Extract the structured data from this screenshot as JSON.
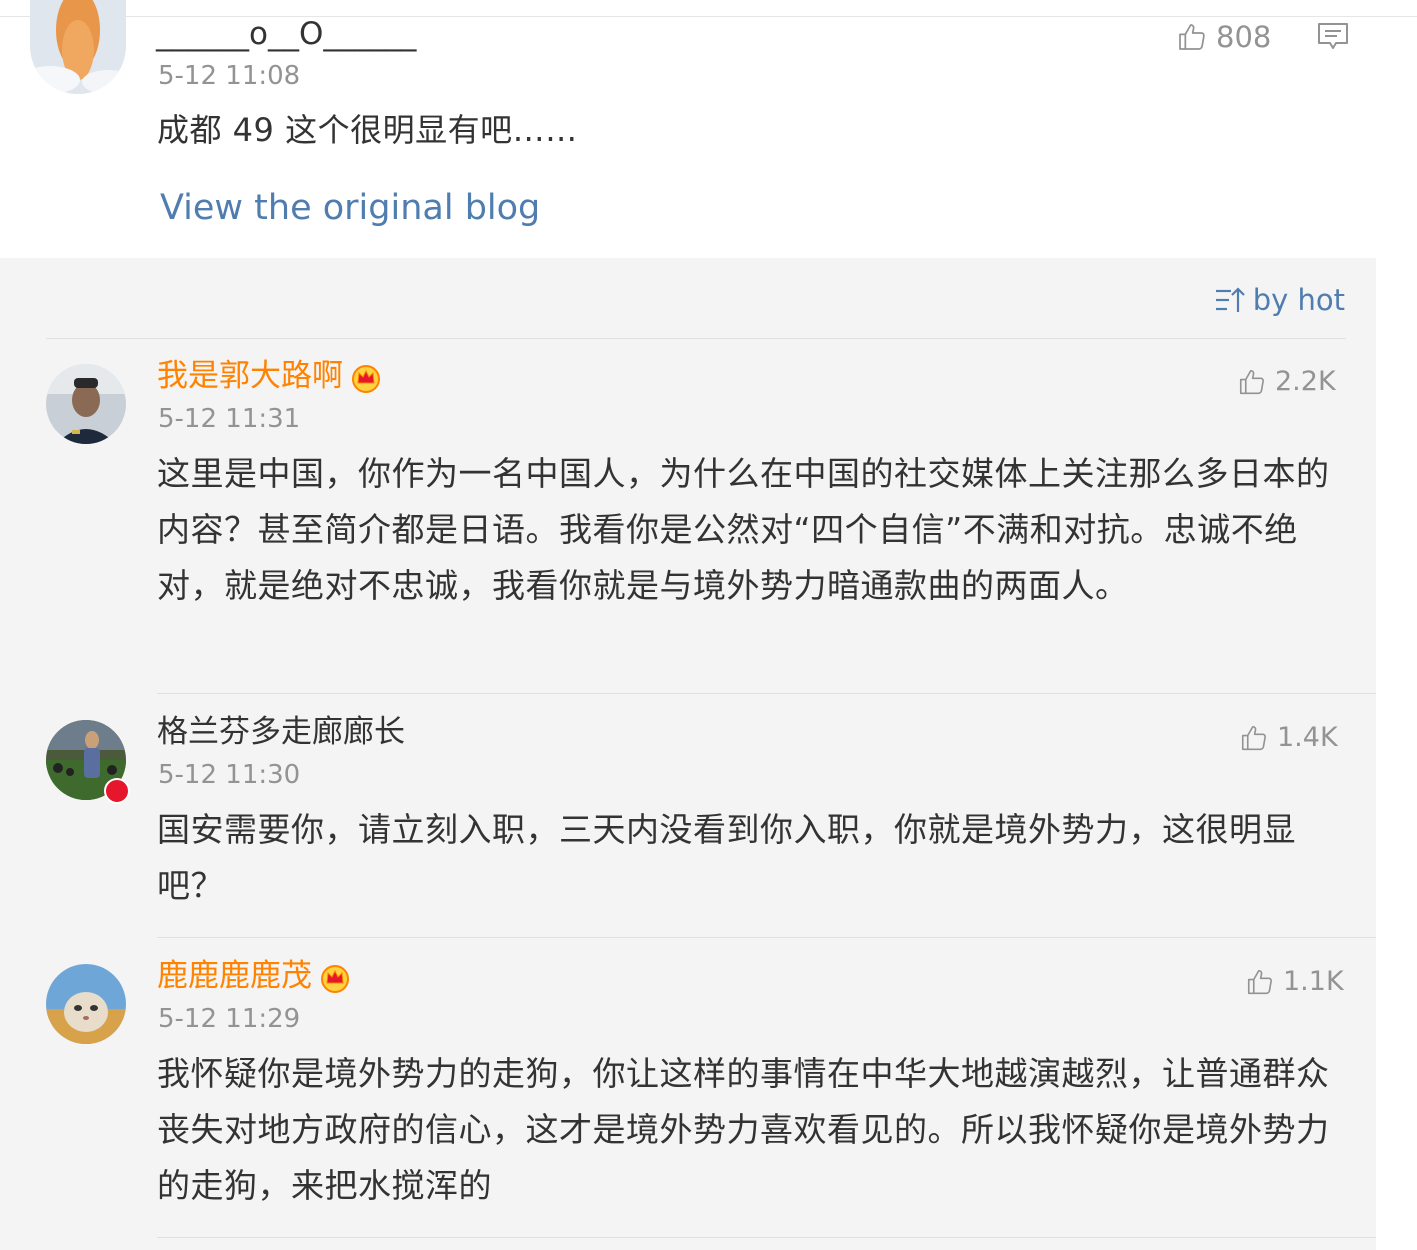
{
  "original_post": {
    "username": "______o__O______",
    "time": "5-12 11:08",
    "likes": "808",
    "text": "成都 49 这个很明显有吧……",
    "view_link": "View the original blog"
  },
  "sort": {
    "label": "by hot"
  },
  "comments": [
    {
      "username": "我是郭大路啊",
      "time": "5-12 11:31",
      "likes": "2.2K",
      "text": "这里是中国，你作为一名中国人，为什么在中国的社交媒体上关注那么多日本的内容？甚至简介都是日语。我看你是公然对“四个自信”不满和对抗。忠诚不绝对，就是绝对不忠诚，我看你就是与境外势力暗通款曲的两面人。"
    },
    {
      "username": "格兰芬多走廊廊长",
      "time": "5-12 11:30",
      "likes": "1.4K",
      "text": "国安需要你，请立刻入职，三天内没看到你入职，你就是境外势力，这很明显吧？"
    },
    {
      "username": "鹿鹿鹿鹿茂",
      "time": "5-12 11:29",
      "likes": "1.1K",
      "text": "我怀疑你是境外势力的走狗，你让这样的事情在中华大地越演越烈，让普通群众丧失对地方政府的信心，这才是境外势力喜欢看见的。所以我怀疑你是境外势力的走狗，来把水搅浑的"
    }
  ]
}
